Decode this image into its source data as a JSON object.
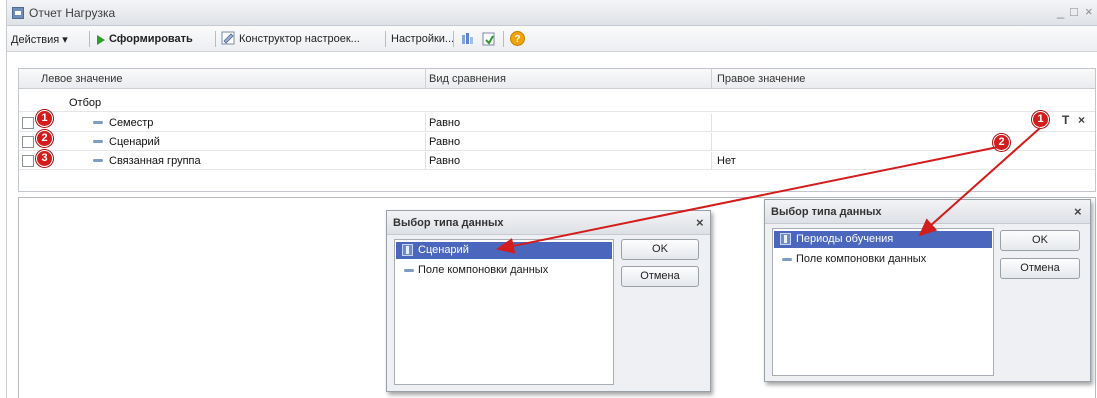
{
  "window": {
    "title": "Отчет  Нагрузка",
    "controls": {
      "minimize": "_",
      "maximize": "□",
      "close": "×"
    }
  },
  "toolbar": {
    "actions_label": "Действия ▾",
    "generate_label": "Сформировать",
    "constructor_label": "Конструктор настроек...",
    "settings_label": "Настройки...",
    "help_label": "?"
  },
  "table": {
    "columns": [
      "Левое значение",
      "Вид сравнения",
      "Правое значение"
    ],
    "group_label": "Отбор",
    "rows": [
      {
        "badge": "1",
        "left": "Семестр",
        "comparison": "Равно",
        "right": ""
      },
      {
        "badge": "2",
        "left": "Сценарий",
        "comparison": "Равно",
        "right": ""
      },
      {
        "badge": "3",
        "left": "Связанная группа",
        "comparison": "Равно",
        "right": "Нет"
      }
    ],
    "right_badges": [
      "1",
      "2"
    ],
    "type_button": "T",
    "clear_button": "×"
  },
  "dialog_left": {
    "title": "Выбор типа данных",
    "items": [
      "Сценарий",
      "Поле компоновки данных"
    ],
    "selected": "Сценарий",
    "ok": "OK",
    "cancel": "Отмена",
    "close": "×"
  },
  "dialog_right": {
    "title": "Выбор типа данных",
    "items": [
      "Периоды обучения",
      "Поле компоновки данных"
    ],
    "selected": "Периоды обучения",
    "ok": "OK",
    "cancel": "Отмена",
    "close": "×"
  },
  "colors": {
    "badge": "#d31c1c",
    "arrow": "#d31c1c",
    "selection": "#4a66bd",
    "generate_icon": "#2aa12a"
  },
  "icons": {
    "window": "app-window-icon",
    "generate": "play-icon",
    "constructor": "constructor-icon",
    "help": "help-icon",
    "field": "dash-icon",
    "type": "grid-icon"
  }
}
